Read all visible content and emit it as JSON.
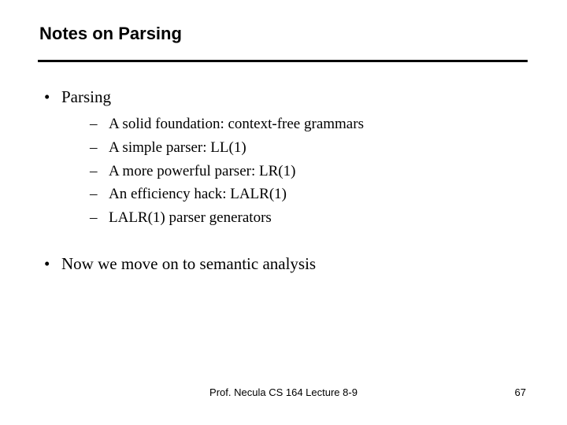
{
  "title": "Notes on Parsing",
  "bullets": {
    "b1": {
      "label": "Parsing",
      "items": [
        "A solid foundation: context-free grammars",
        "A simple parser: LL(1)",
        "A more powerful parser: LR(1)",
        "An efficiency hack: LALR(1)",
        "LALR(1) parser generators"
      ]
    },
    "b2": {
      "label": "Now we move on to semantic analysis"
    }
  },
  "footer": {
    "center": "Prof. Necula  CS 164  Lecture 8-9",
    "page": "67"
  }
}
